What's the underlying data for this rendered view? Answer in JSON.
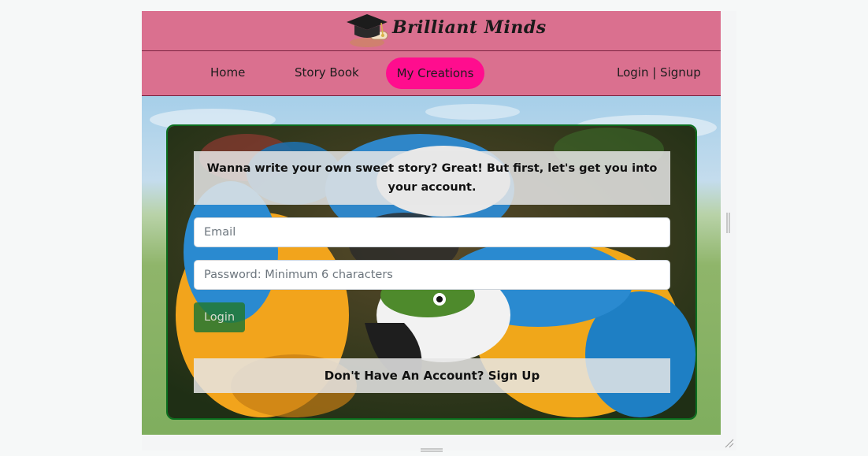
{
  "brand": {
    "name": "Brilliant Minds",
    "logo_icon": "graduation-cap-icon"
  },
  "nav": {
    "home": "Home",
    "story_book": "Story Book",
    "my_creations": "My Creations",
    "auth": "Login | Signup",
    "active_color": "#ff0d8e"
  },
  "login_form": {
    "notice": "Wanna write your own sweet story? Great! But first, let's get you into your account.",
    "email_placeholder": "Email",
    "password_placeholder": "Password: Minimum 6 characters",
    "login_button": "Login",
    "signup_prompt": "Don't Have An Account? Sign Up"
  },
  "colors": {
    "header_bg": "#da708f",
    "card_border": "#0b6f1f",
    "login_button_bg": "#227832"
  }
}
